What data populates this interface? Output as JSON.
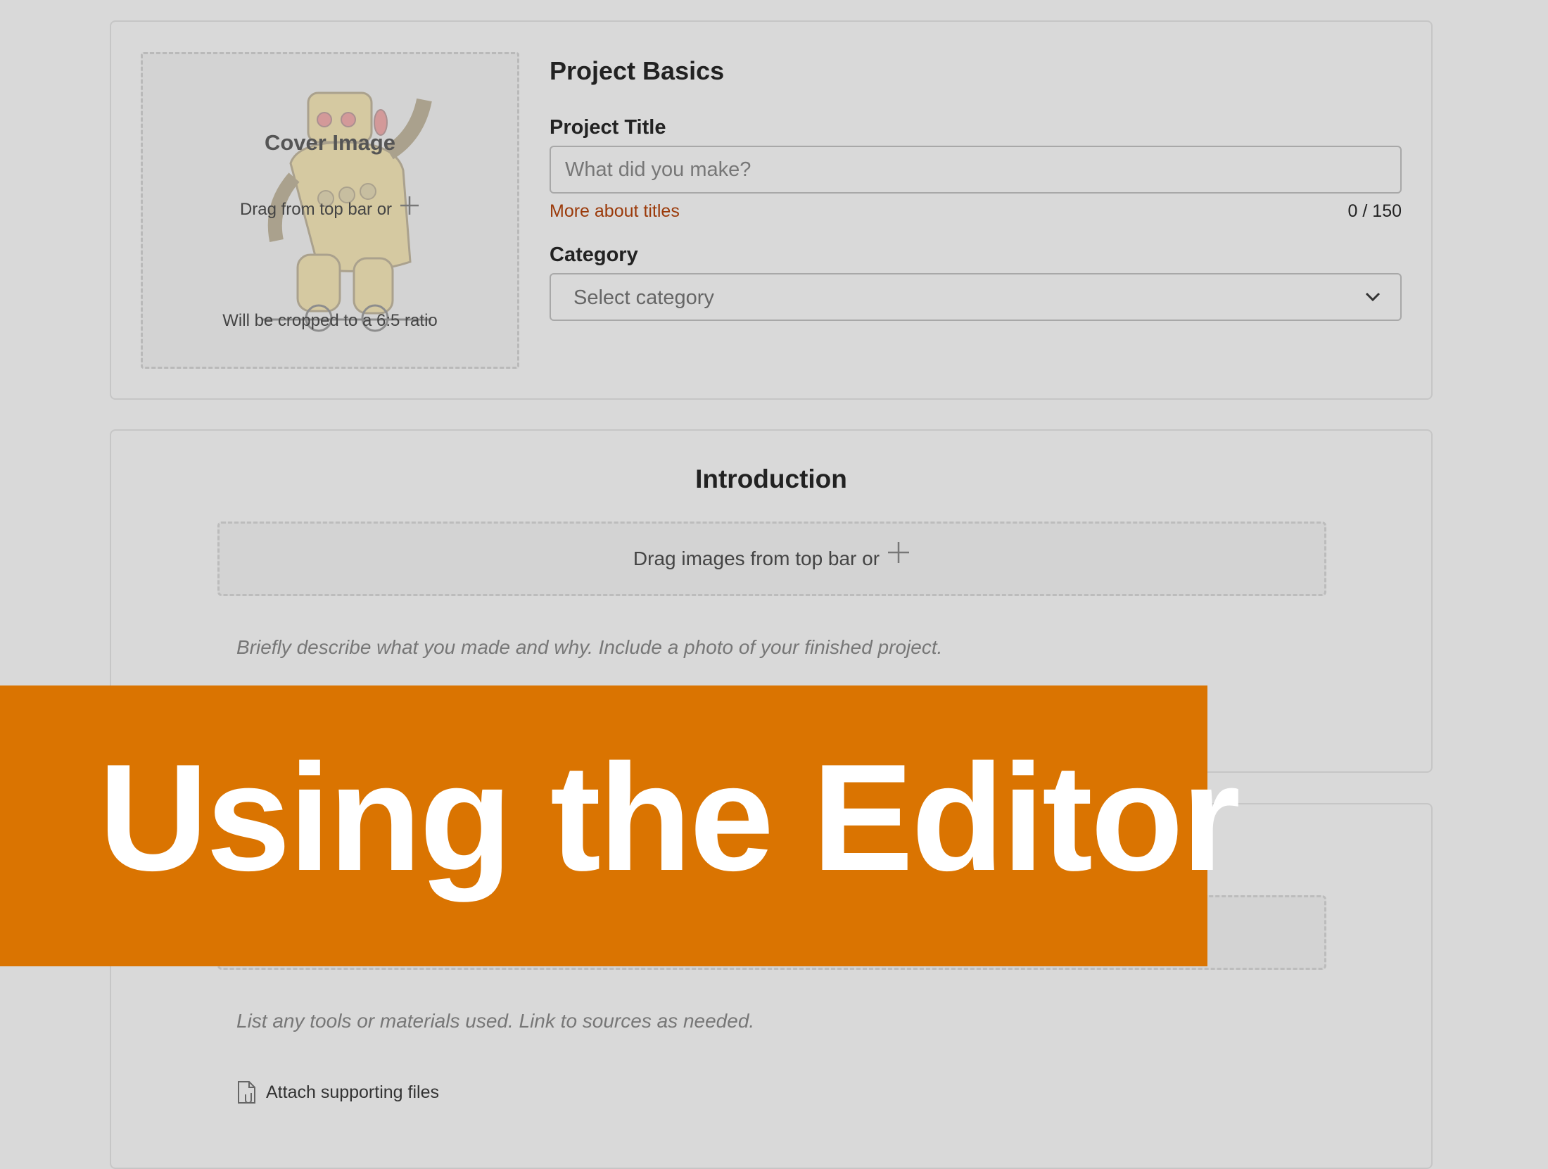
{
  "cover": {
    "title": "Cover Image",
    "drag_text": "Drag from top bar or",
    "crop_note": "Will be cropped to a 6:5 ratio"
  },
  "basics": {
    "section_title": "Project Basics",
    "title_label": "Project Title",
    "title_placeholder": "What did you make?",
    "title_value": "",
    "titles_link": "More about titles",
    "char_count": "0 / 150",
    "category_label": "Category",
    "category_selected": "Select category"
  },
  "intro": {
    "section_title": "Introduction",
    "drag_text": "Drag images from top bar or",
    "description": "Briefly describe what you made and why. Include a photo of your finished project."
  },
  "supplies": {
    "description": "List any tools or materials used. Link to sources as needed.",
    "attach_label": "Attach supporting files"
  },
  "banner": {
    "text": "Using the Editor",
    "color": "#da7401"
  },
  "colors": {
    "link": "#9b3a0a",
    "background": "#d9d9d9"
  }
}
